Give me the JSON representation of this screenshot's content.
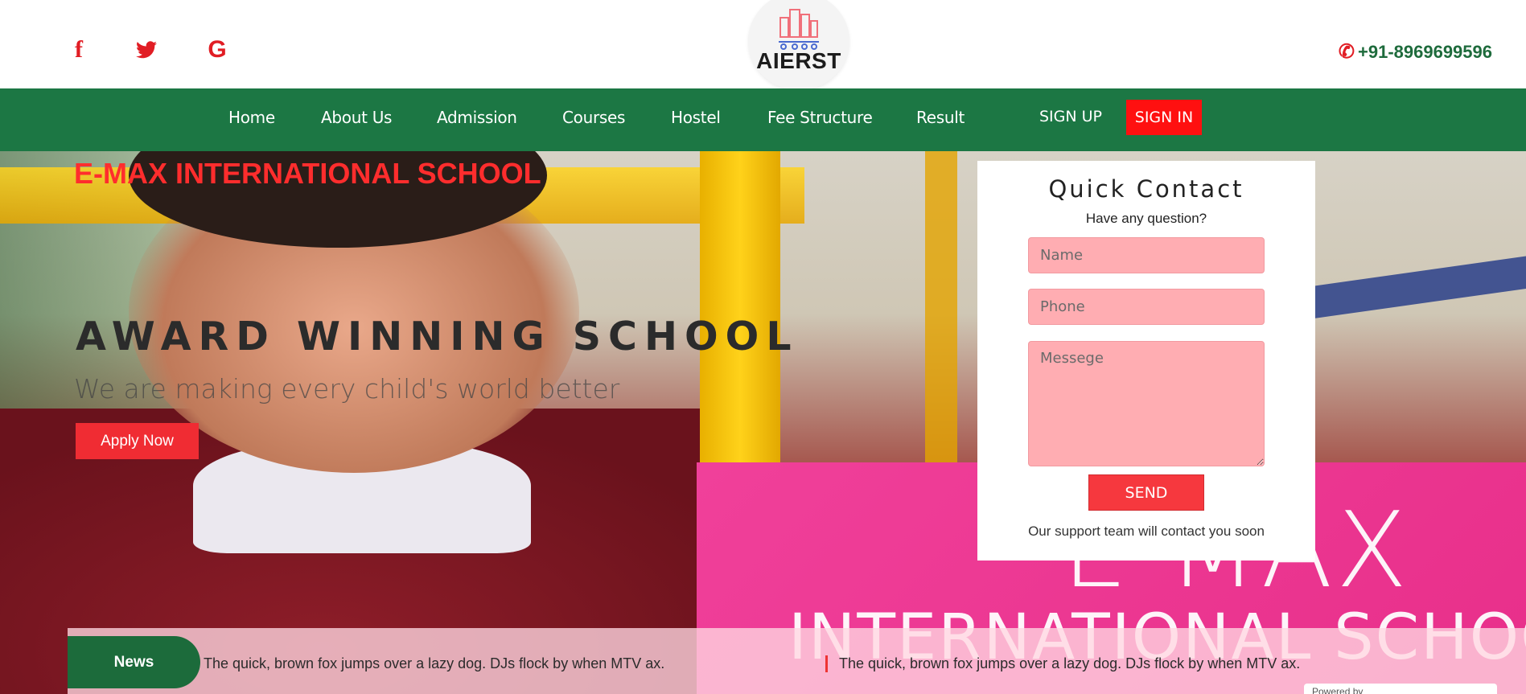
{
  "header": {
    "logo_text": "AIERST",
    "phone": "+91-8969699596",
    "social": [
      "f",
      "t",
      "G"
    ]
  },
  "nav": {
    "items": [
      "Home",
      "About Us",
      "Admission",
      "Courses",
      "Hostel",
      "Fee Structure",
      "Result"
    ],
    "signup": "SIGN UP",
    "signin": "SIGN IN"
  },
  "hero": {
    "school_name": "E-MAX INTERNATIONAL SCHOOL",
    "headline": "AWARD WINNING SCHOOL",
    "tagline": "We are making every child's world better",
    "apply_label": "Apply Now",
    "banner_big": "E MAX",
    "banner_sub": "INTERNATIONAL SCHOOL"
  },
  "quick_contact": {
    "title": "Quick Contact",
    "subtitle": "Have any question?",
    "name_placeholder": "Name",
    "phone_placeholder": "Phone",
    "message_placeholder": "Messege",
    "send_label": "SEND",
    "note": "Our support team will contact you soon"
  },
  "news": {
    "label": "News",
    "items": [
      "The quick, brown fox jumps over a lazy dog. DJs flock by when MTV ax.",
      "The quick, brown fox jumps over a lazy dog. DJs flock by when MTV ax."
    ]
  },
  "footer": {
    "powered": "Powered by"
  },
  "colors": {
    "brand_green": "#1c7744",
    "accent_red": "#ff1010",
    "field_pink": "#ffadb2"
  }
}
